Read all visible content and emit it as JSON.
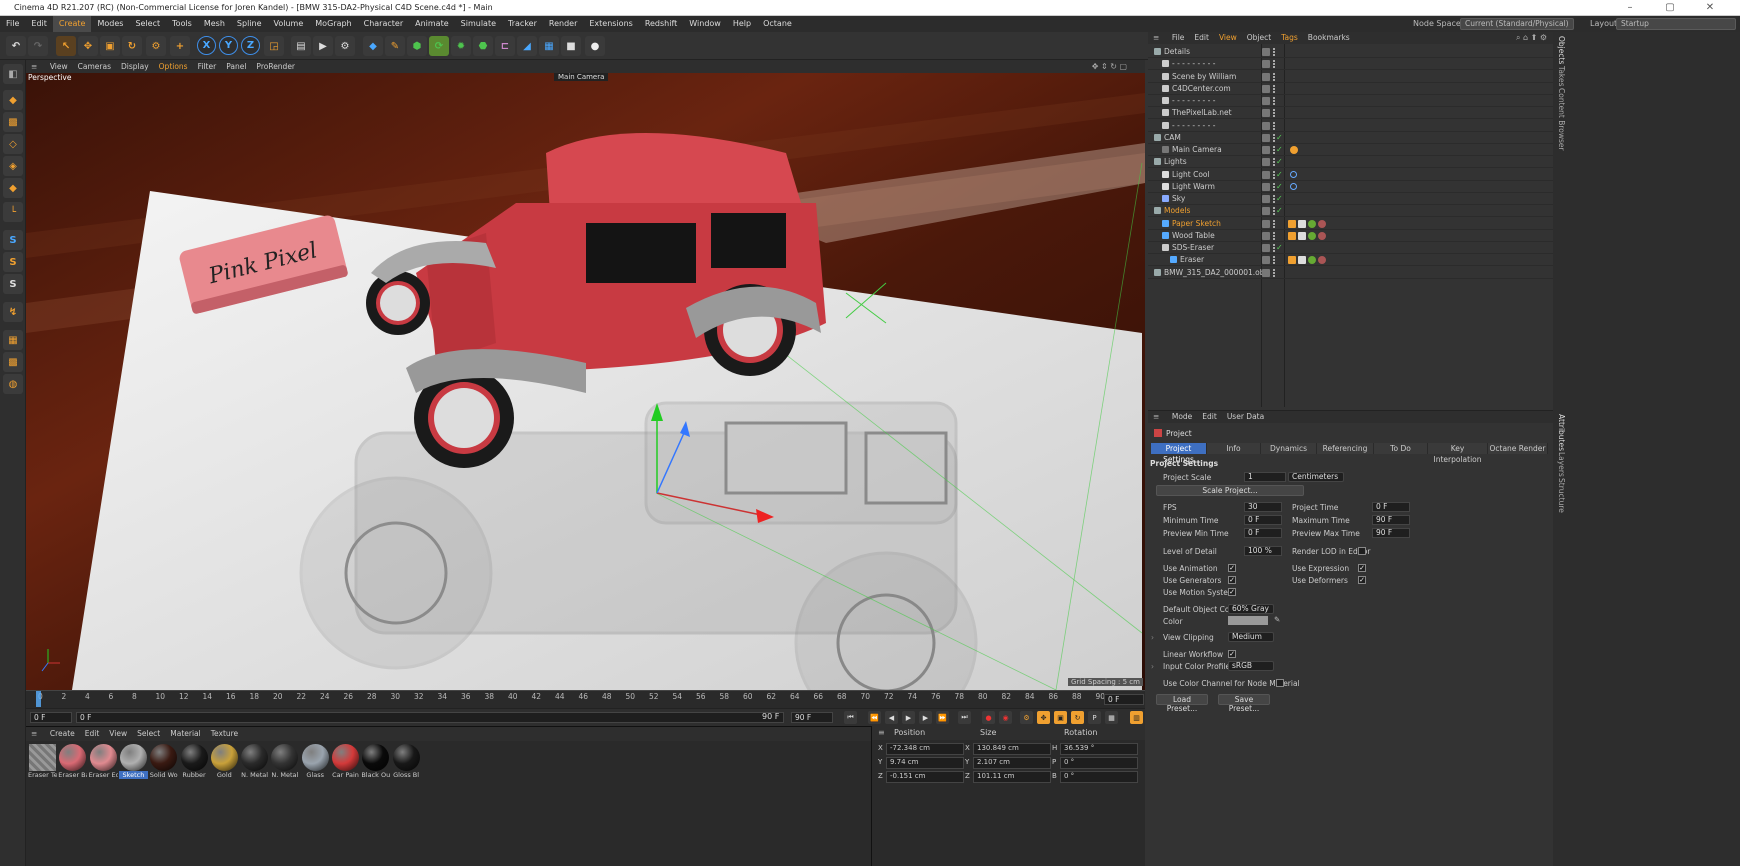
{
  "window": {
    "title": "Cinema 4D R21.207 (RC) (Non-Commercial License for Joren Kandel) - [BMW 315-DA2-Physical C4D Scene.c4d *] - Main"
  },
  "menu": {
    "items": [
      "File",
      "Edit",
      "Create",
      "Modes",
      "Select",
      "Tools",
      "Mesh",
      "Spline",
      "Volume",
      "MoGraph",
      "Character",
      "Animate",
      "Simulate",
      "Tracker",
      "Render",
      "Extensions",
      "Redshift",
      "Window",
      "Help",
      "Octane"
    ],
    "active": "Create",
    "node_space_label": "Node Space:",
    "node_space_value": "Current (Standard/Physical)",
    "layout_label": "Layout:",
    "layout_value": "Startup"
  },
  "viewport": {
    "menu": [
      "View",
      "Cameras",
      "Display",
      "Options",
      "Filter",
      "Panel",
      "ProRender"
    ],
    "view_name": "Perspective",
    "camera_name": "Main Camera",
    "eraser_text": "Pink Pixel",
    "grid_spacing": "Grid Spacing : 5 cm"
  },
  "timeline": {
    "ticks": [
      "0",
      "2",
      "4",
      "6",
      "8",
      "10",
      "12",
      "14",
      "16",
      "18",
      "20",
      "22",
      "24",
      "26",
      "28",
      "30",
      "32",
      "34",
      "36",
      "38",
      "40",
      "42",
      "44",
      "46",
      "48",
      "50",
      "52",
      "54",
      "56",
      "58",
      "60",
      "62",
      "64",
      "66",
      "68",
      "70",
      "72",
      "74",
      "76",
      "78",
      "80",
      "82",
      "84",
      "86",
      "88",
      "90"
    ],
    "current_frame": "0 F",
    "start": "0 F",
    "preview_start": "0 F",
    "end": "90 F",
    "preview_end": "90 F"
  },
  "materials": {
    "menu": [
      "Create",
      "Edit",
      "View",
      "Select",
      "Material",
      "Texture"
    ],
    "items": [
      {
        "name": "Eraser Te",
        "color": "#8a8a8a"
      },
      {
        "name": "Eraser Ba",
        "color": "#d96a74"
      },
      {
        "name": "Eraser Ed",
        "color": "#e08a90"
      },
      {
        "name": "Sketch",
        "color": "#b0b0b0"
      },
      {
        "name": "Solid Wo",
        "color": "#3a1a12"
      },
      {
        "name": "Rubber",
        "color": "#1a1a1a"
      },
      {
        "name": "Gold",
        "color": "#c9a13a"
      },
      {
        "name": "N. Metal",
        "color": "#2a2a2a"
      },
      {
        "name": "N. Metal",
        "color": "#333333"
      },
      {
        "name": "Glass",
        "color": "#9aa4ae"
      },
      {
        "name": "Car Pain",
        "color": "#d43a3a"
      },
      {
        "name": "Black Ou",
        "color": "#0a0a0a"
      },
      {
        "name": "Gloss Bl",
        "color": "#181818"
      }
    ]
  },
  "coordinates": {
    "headers": [
      "Position",
      "Size",
      "Rotation"
    ],
    "rows": [
      {
        "pl": "X",
        "pv": "-72.348 cm",
        "sl": "X",
        "sv": "130.849 cm",
        "rl": "H",
        "rv": "36.539 °"
      },
      {
        "pl": "Y",
        "pv": "9.74 cm",
        "sl": "Y",
        "sv": "2.107 cm",
        "rl": "P",
        "rv": "0 °"
      },
      {
        "pl": "Z",
        "pv": "-0.151 cm",
        "sl": "Z",
        "sv": "101.11 cm",
        "rl": "B",
        "rv": "0 °"
      }
    ]
  },
  "objects": {
    "menu": [
      "File",
      "Edit",
      "View",
      "Object",
      "Tags",
      "Bookmarks"
    ],
    "rows": [
      {
        "name": "Details",
        "indent": 0,
        "color": "#ccc"
      },
      {
        "name": "- - - - - - - - -",
        "indent": 1,
        "color": "#ccc"
      },
      {
        "name": "Scene by William",
        "indent": 1,
        "color": "#ccc"
      },
      {
        "name": "C4DCenter.com",
        "indent": 1,
        "color": "#ccc"
      },
      {
        "name": "- - - - - - - - -",
        "indent": 1,
        "color": "#ccc"
      },
      {
        "name": "ThePixelLab.net",
        "indent": 1,
        "color": "#ccc"
      },
      {
        "name": "- - - - - - - - -",
        "indent": 1,
        "color": "#ccc"
      },
      {
        "name": "CAM",
        "indent": 0,
        "color": "#ccc"
      },
      {
        "name": "Main Camera",
        "indent": 1,
        "color": "#ccc"
      },
      {
        "name": "Lights",
        "indent": 0,
        "color": "#ccc"
      },
      {
        "name": "Light Cool",
        "indent": 1,
        "color": "#ccc"
      },
      {
        "name": "Light Warm",
        "indent": 1,
        "color": "#ccc"
      },
      {
        "name": "Sky",
        "indent": 1,
        "color": "#ccc"
      },
      {
        "name": "Models",
        "indent": 0,
        "color": "#f0a030"
      },
      {
        "name": "Paper Sketch",
        "indent": 1,
        "color": "#f0a030"
      },
      {
        "name": "Wood Table",
        "indent": 1,
        "color": "#ccc"
      },
      {
        "name": "SDS-Eraser",
        "indent": 1,
        "color": "#ccc"
      },
      {
        "name": "Eraser",
        "indent": 2,
        "color": "#ccc"
      },
      {
        "name": "BMW_315_DA2_000001.obj",
        "indent": 0,
        "color": "#ccc"
      }
    ]
  },
  "attributes": {
    "menu": [
      "Mode",
      "Edit",
      "User Data"
    ],
    "object": "Project",
    "tabs": [
      "Project Settings",
      "Info",
      "Dynamics",
      "Referencing",
      "To Do",
      "Key Interpolation",
      "Octane Render"
    ],
    "section": "Project Settings",
    "project_scale_label": "Project Scale",
    "project_scale": "1",
    "project_scale_unit": "Centimeters",
    "scale_project_btn": "Scale Project...",
    "fps_label": "FPS",
    "fps": "30",
    "project_time_label": "Project Time",
    "project_time": "0 F",
    "min_time_label": "Minimum Time",
    "min_time": "0 F",
    "max_time_label": "Maximum Time",
    "max_time": "90 F",
    "pmin_label": "Preview Min Time",
    "pmin": "0 F",
    "pmax_label": "Preview Max Time",
    "pmax": "90 F",
    "lod_label": "Level of Detail",
    "lod": "100 %",
    "render_lod_label": "Render LOD in Editor",
    "use_anim_label": "Use Animation",
    "use_expr_label": "Use Expression",
    "use_gen_label": "Use Generators",
    "use_def_label": "Use Deformers",
    "use_motion_label": "Use Motion System",
    "def_color_label": "Default Object Color",
    "def_color": "60% Gray",
    "color_label": "Color",
    "view_clip_label": "View Clipping",
    "view_clip": "Medium",
    "linear_label": "Linear Workflow",
    "icp_label": "Input Color Profile",
    "icp": "sRGB",
    "ucc_label": "Use Color Channel for Node Material",
    "load_btn": "Load Preset...",
    "save_btn": "Save Preset..."
  },
  "side_tabs": [
    "Objects",
    "Takes",
    "Content Browser",
    "Attributes",
    "Layers",
    "Structure"
  ]
}
